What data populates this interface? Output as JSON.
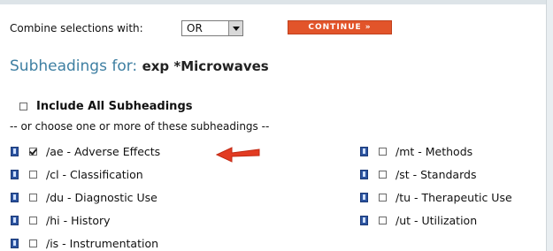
{
  "combine": {
    "label": "Combine selections with:",
    "value": "OR"
  },
  "continue_label": "CONTINUE »",
  "subheadings": {
    "prefix": "Subheadings for:",
    "term": "exp *Microwaves"
  },
  "include_all_label": "Include All Subheadings",
  "choose_text": "-- or choose one or more of these subheadings --",
  "left_column": [
    {
      "label": "/ae - Adverse Effects",
      "checked": true
    },
    {
      "label": "/cl - Classification",
      "checked": false
    },
    {
      "label": "/du - Diagnostic Use",
      "checked": false
    },
    {
      "label": "/hi - History",
      "checked": false
    },
    {
      "label": "/is - Instrumentation",
      "checked": false
    }
  ],
  "right_column": [
    {
      "label": "/mt - Methods",
      "checked": false
    },
    {
      "label": "/st - Standards",
      "checked": false
    },
    {
      "label": "/tu - Therapeutic Use",
      "checked": false
    },
    {
      "label": "/ut - Utilization",
      "checked": false
    }
  ],
  "colors": {
    "continue_bg": "#e2542a",
    "heading": "#3e7fa2",
    "info_icon": "#2c54a0",
    "arrow": "#e23b22"
  },
  "icons": [
    "info-icon",
    "dropdown-arrow-icon",
    "red-arrow-icon"
  ]
}
